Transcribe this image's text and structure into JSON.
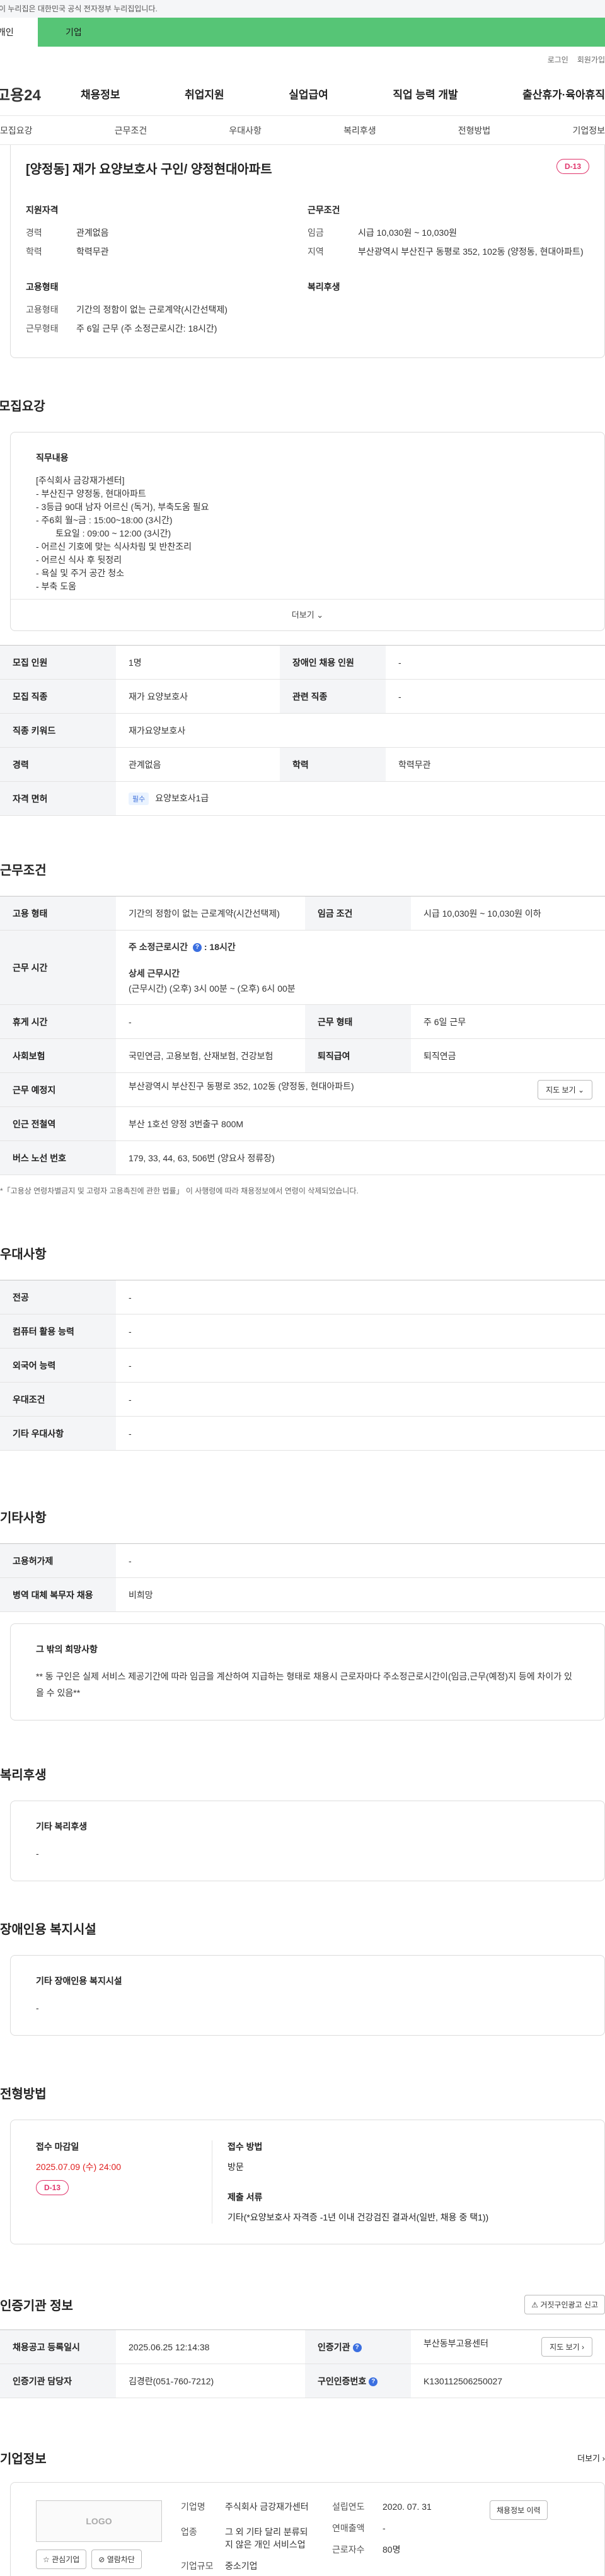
{
  "gov_notice": "이 누리집은 대한민국 공식 전자정부 누리집입니다.",
  "top_tabs": {
    "personal": "개인",
    "corp": "기업"
  },
  "util": {
    "login": "로그인",
    "join": "회원가입"
  },
  "logo": "고용24",
  "gnb": [
    "채용정보",
    "취업지원",
    "실업급여",
    "직업 능력 개발",
    "출산휴가·육아휴직"
  ],
  "anchors": [
    "모집요강",
    "근무조건",
    "우대사항",
    "복리후생",
    "전형방법",
    "기업정보"
  ],
  "title": "[양정동] 재가 요양보호사 구인/ 양정현대아파트",
  "dday": "D-13",
  "summary": {
    "qual_h": "지원자격",
    "career_k": "경력",
    "career_v": "관계없음",
    "edu_k": "학력",
    "edu_v": "학력무관",
    "cond_h": "근무조건",
    "wage_k": "임금",
    "wage_v": "시급 10,030원 ~ 10,030원",
    "area_k": "지역",
    "area_v": "부산광역시 부산진구 동평로 352, 102동 (양정동, 현대아파트)",
    "emp_h": "고용형태",
    "type_k": "고용형태",
    "type_v": "기간의 정함이 없는 근로계약(시간선택제)",
    "worktype_k": "근무형태",
    "worktype_v": "주 6일 근무 (주 소정근로시간: 18시간)",
    "welfare_h": "복리후생"
  },
  "recruit": {
    "h": "모집요강",
    "duty_h": "직무내용",
    "duty_text": "[주식회사 금강재가센터]\n- 부산진구 양정동, 현대아파트\n- 3등급 90대 남자 어르신 (독거), 부축도움 필요\n- 주6회 월~금 : 15:00~18:00 (3시간)\n        토요일 : 09:00 ~ 12:00 (3시간)\n- 어르신 기호에 맞는 식사차림 및 반찬조리\n- 어르신 식사 후 뒷정리\n- 욕실 및 주거 공간 청소\n- 부축 도움",
    "more": "더보기",
    "rows": {
      "cnt_k": "모집 인원",
      "cnt_v": "1명",
      "dis_k": "장애인 채용 인원",
      "dis_v": "-",
      "job_k": "모집 직종",
      "job_v": "재가 요양보호사",
      "rel_k": "관련 직종",
      "rel_v": "-",
      "kw_k": "직종 키워드",
      "kw_v": "재가요양보호사",
      "car_k": "경력",
      "car_v": "관계없음",
      "edu_k": "학력",
      "edu_v": "학력무관",
      "lic_k": "자격 면허",
      "lic_badge": "필수",
      "lic_v": "요양보호사1급"
    }
  },
  "cond": {
    "h": "근무조건",
    "type_k": "고용 형태",
    "type_v": "기간의 정함이 없는 근로계약(시간선택제)",
    "wage_k": "임금 조건",
    "wage_v": "시급 10,030원 ~ 10,030원 이하",
    "time_k": "근무 시간",
    "weekly_label": "주 소정근로시간",
    "weekly_v": "18시간",
    "detail_label": "상세 근무시간",
    "detail_v": "(근무시간) (오후) 3시 00분 ~ (오후) 6시 00분",
    "rest_k": "휴게 시간",
    "rest_v": "-",
    "form_k": "근무 형태",
    "form_v": "주 6일 근무",
    "ins_k": "사회보험",
    "ins_v": "국민연금, 고용보험, 산재보험, 건강보험",
    "ret_k": "퇴직급여",
    "ret_v": "퇴직연금",
    "place_k": "근무 예정지",
    "place_v": "부산광역시 부산진구 동평로 352, 102동 (양정동, 현대아파트)",
    "map_btn": "지도 보기",
    "subway_k": "인근 전철역",
    "subway_v": "부산 1호선 양정 3번출구 800M",
    "bus_k": "버스 노선 번호",
    "bus_v": "179, 33, 44, 63, 506번 (양요사 정류장)",
    "note": "*「고용상 연령차별금지 및 고령자 고용촉진에 관한 법률」 이 사행령에 따라 채용정보에서 연령이 삭제되었습니다."
  },
  "pref": {
    "h": "우대사항",
    "rows": [
      {
        "k": "전공",
        "v": "-"
      },
      {
        "k": "컴퓨터 활용 능력",
        "v": "-"
      },
      {
        "k": "외국어 능력",
        "v": "-"
      },
      {
        "k": "우대조건",
        "v": "-"
      },
      {
        "k": "기타 우대사항",
        "v": "-"
      }
    ]
  },
  "etc": {
    "h": "기타사항",
    "r1_k": "고용허가제",
    "r1_v": "-",
    "r2_k": "병역 대체 복무자 채용",
    "r2_v": "비희망",
    "box_h": "그 밖의 희망사항",
    "box_v": "** 동 구인은 실제 서비스 제공기간에 따라 임금을 계산하여 지급하는 형태로 채용시 근로자마다 주소정근로시간이(임금,근무(예정)지 등에 차이가 있을 수 있음**"
  },
  "welfare": {
    "h": "복리후생",
    "box_h": "기타 복리후생",
    "box_v": "-"
  },
  "disab": {
    "h": "장애인용 복지시설",
    "box_h": "기타 장애인용 복지시설",
    "box_v": "-"
  },
  "select": {
    "h": "전형방법",
    "deadline_h": "접수 마감일",
    "deadline_v": "2025.07.09 (수) 24:00",
    "dday": "D-13",
    "method_h": "접수 방법",
    "method_v": "방문",
    "docs_h": "제출 서류",
    "docs_v": "기타(*요양보호사 자격증 -1년 이내 건강검진 결과서(일반, 채용 중 택1))"
  },
  "agency": {
    "h": "인증기관 정보",
    "report_btn": "거짓구인광고 신고",
    "reg_k": "채용공고 등록일시",
    "reg_v": "2025.06.25 12:14:38",
    "org_k": "인증기관",
    "org_v": "부산동부고용센터",
    "map_btn": "지도 보기",
    "mgr_k": "인증기관 담당자",
    "mgr_v": "김경란(051-760-7212)",
    "no_k": "구인인증번호",
    "no_v": "K130112506250027"
  },
  "company": {
    "h": "기업정보",
    "more": "더보기",
    "logo": "LOGO",
    "fav_btn": "관심기업",
    "block_btn": "열람차단",
    "name_k": "기업명",
    "name_v": "주식회사 금강재가센터",
    "ind_k": "업종",
    "ind_v": "그 외 기타 달리 분류되지 않은 개인 서비스업",
    "size_k": "기업규모",
    "size_v": "중소기업",
    "est_k": "설립연도",
    "est_v": "2020. 07. 31",
    "sales_k": "연매출액",
    "sales_v": "-",
    "emp_k": "근로자수",
    "emp_v": "80명",
    "history_btn": "채용정보 이력"
  }
}
